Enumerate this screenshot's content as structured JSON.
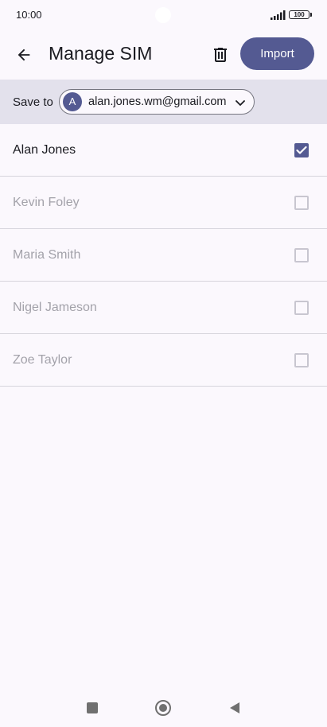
{
  "status_bar": {
    "time": "10:00",
    "battery": "100"
  },
  "app_bar": {
    "title": "Manage SIM",
    "import_label": "Import",
    "back_icon": "arrow-back-icon",
    "delete_icon": "trash-icon"
  },
  "save_to": {
    "label": "Save to",
    "avatar_initial": "A",
    "account_email": "alan.jones.wm@gmail.com"
  },
  "contacts": [
    {
      "name": "Alan Jones",
      "checked": true,
      "enabled": true
    },
    {
      "name": "Kevin Foley",
      "checked": false,
      "enabled": false
    },
    {
      "name": "Maria Smith",
      "checked": false,
      "enabled": false
    },
    {
      "name": "Nigel Jameson",
      "checked": false,
      "enabled": false
    },
    {
      "name": "Zoe Taylor",
      "checked": false,
      "enabled": false
    }
  ],
  "colors": {
    "accent": "#545a92",
    "background": "#fbf8fd",
    "save_bar": "#e3e1ec",
    "disabled_text": "#a3a2aa"
  },
  "nav_bar": {
    "icons": [
      "square-recents-icon",
      "circle-home-icon",
      "triangle-back-icon"
    ]
  }
}
